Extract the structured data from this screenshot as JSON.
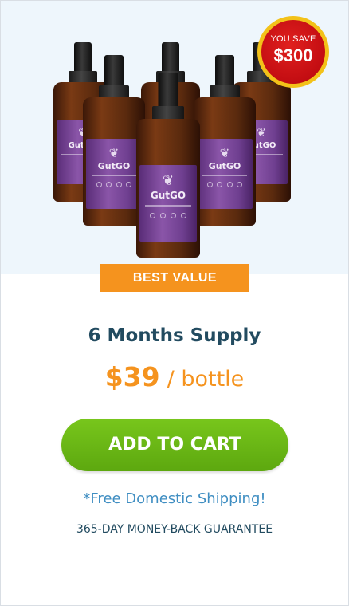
{
  "product": {
    "brand": "GutGO",
    "bottle_icon": "leaf-figure-icon"
  },
  "badge": {
    "top_text": "YOU SAVE",
    "amount": "$300",
    "color": "#c30d12",
    "ring_color": "#f3c219"
  },
  "ribbon": {
    "label": "BEST VALUE",
    "color": "#f5931e"
  },
  "offer": {
    "title": "6 Months Supply",
    "price": "$39",
    "unit": "/ bottle"
  },
  "cta": {
    "label": "ADD TO CART",
    "color": "#6ab716"
  },
  "notes": {
    "shipping": "*Free Domestic Shipping!",
    "guarantee": "365-DAY MONEY-BACK GUARANTEE"
  }
}
